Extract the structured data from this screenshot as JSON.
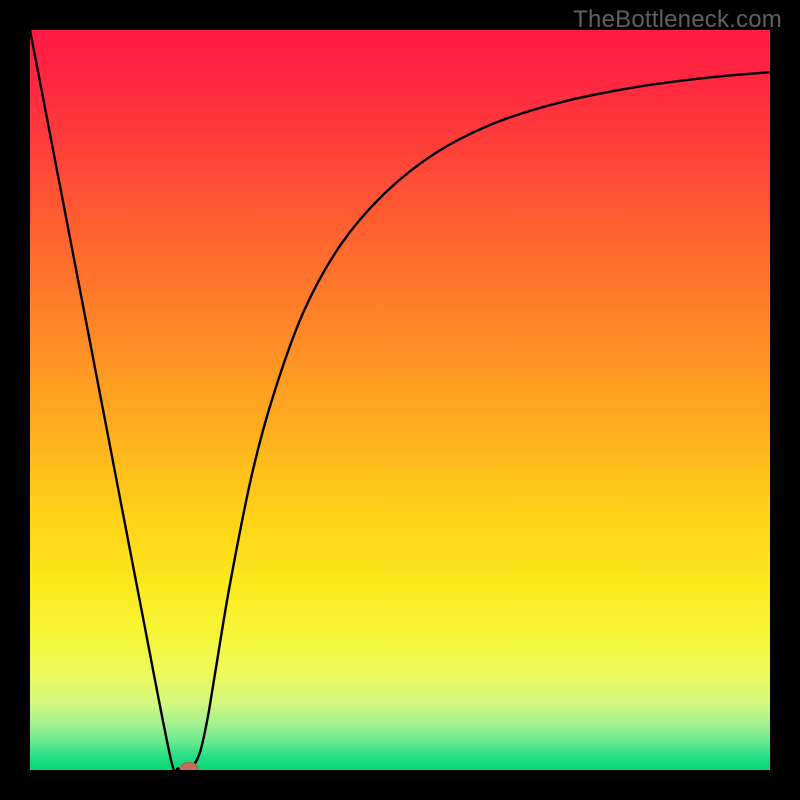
{
  "watermark": "TheBottleneck.com",
  "chart_data": {
    "type": "line",
    "title": "",
    "xlabel": "",
    "ylabel": "",
    "xlim": [
      0,
      100
    ],
    "ylim": [
      0,
      100
    ],
    "background": "gradient (green at bottom → red at top)",
    "series": [
      {
        "name": "bottleneck-curve",
        "x": [
          0,
          5,
          10,
          15,
          19,
          20,
          21,
          22,
          23,
          24,
          25,
          27,
          30,
          33,
          37,
          42,
          48,
          55,
          63,
          72,
          82,
          92,
          100
        ],
        "y": [
          100,
          74,
          48,
          22,
          1.6,
          0.2,
          0.1,
          0.5,
          2.5,
          7,
          13,
          25,
          40,
          51,
          62,
          71,
          78,
          83.5,
          87.5,
          90.3,
          92.3,
          93.6,
          94.3
        ]
      }
    ],
    "marker": {
      "x": 21.5,
      "y": 0.2,
      "name": "optimal-point"
    },
    "gradient_stops": [
      {
        "pos": 0.0,
        "color": "#ff1a43"
      },
      {
        "pos": 0.3,
        "color": "#ff6a2e"
      },
      {
        "pos": 0.55,
        "color": "#ffb11e"
      },
      {
        "pos": 0.75,
        "color": "#fbe91d"
      },
      {
        "pos": 0.94,
        "color": "#9cf18f"
      },
      {
        "pos": 1.0,
        "color": "#05d877"
      }
    ]
  }
}
